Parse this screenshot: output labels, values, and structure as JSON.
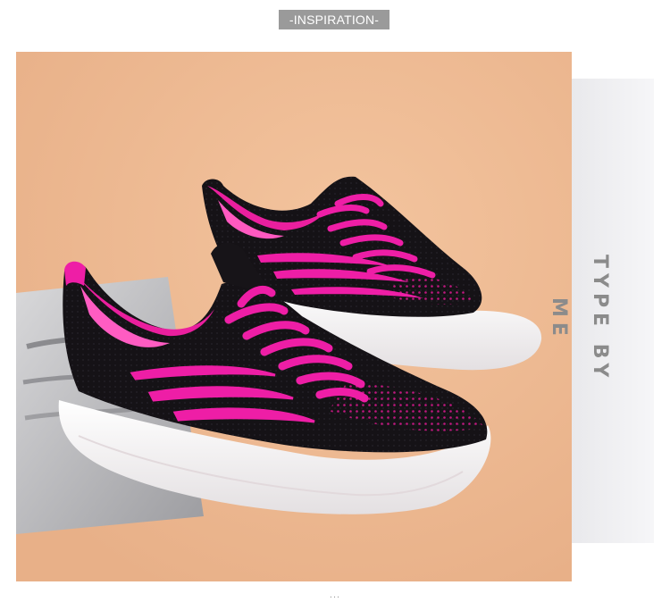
{
  "badge": {
    "text": "-INSPIRATION-"
  },
  "side_label": {
    "text": "TYPE BY ME"
  },
  "caption": {
    "text": "..."
  },
  "colors": {
    "background": "#eeb990",
    "shoe_body": "#131114",
    "accent": "#ee1ea6",
    "sole": "#ffffff",
    "badge_bg": "#9a9a9a",
    "side_text": "#8b8b8b"
  },
  "photo": {
    "subject": "pair of black knit sneakers with pink laces",
    "props": [
      "grey-paper-sheet"
    ]
  }
}
